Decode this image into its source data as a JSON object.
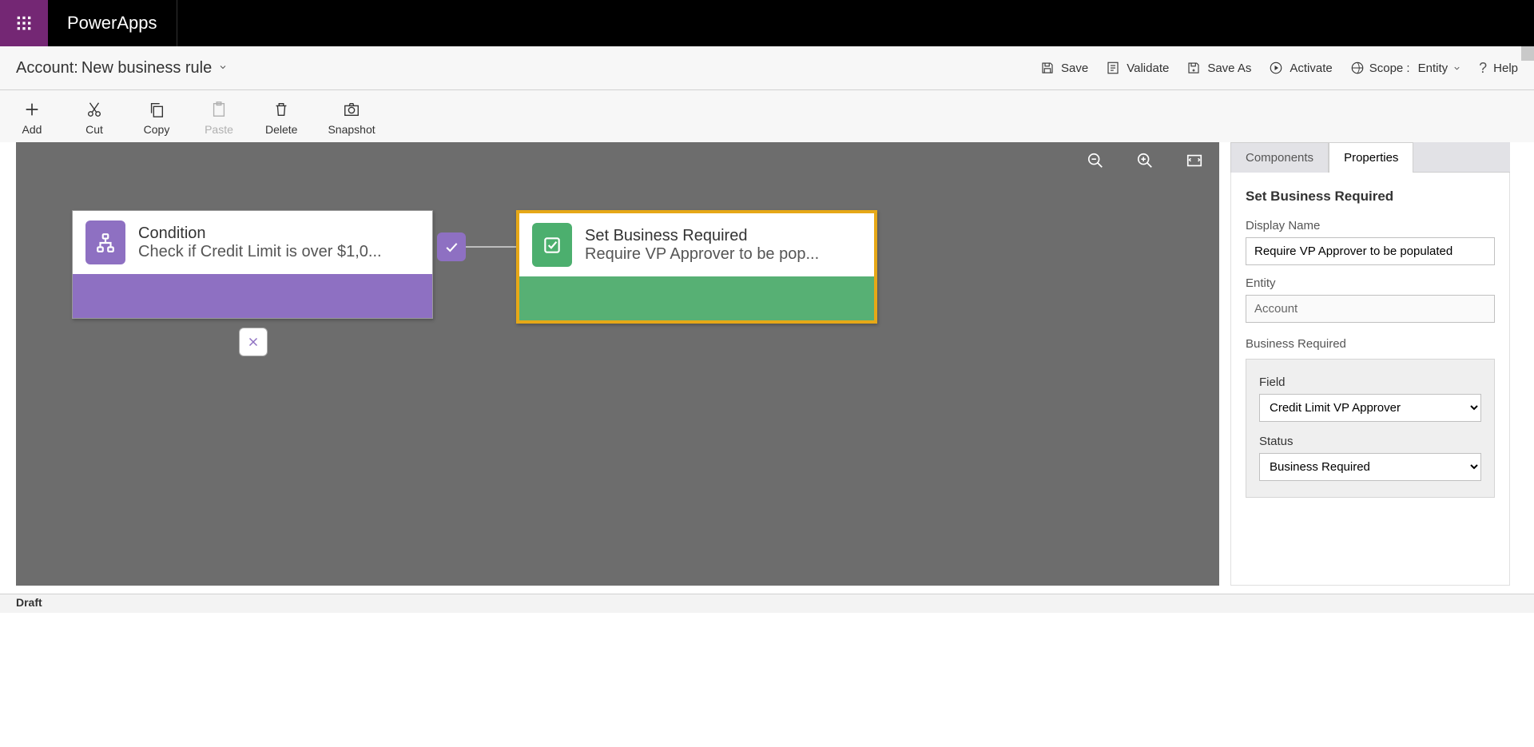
{
  "brand": "PowerApps",
  "breadcrumb": {
    "entity": "Account:",
    "name": "New business rule"
  },
  "cmdbar": {
    "save": "Save",
    "validate": "Validate",
    "saveas": "Save As",
    "activate": "Activate",
    "scope_label": "Scope :",
    "scope_value": "Entity",
    "help": "Help"
  },
  "toolbar": {
    "add": "Add",
    "cut": "Cut",
    "copy": "Copy",
    "paste": "Paste",
    "delete": "Delete",
    "snapshot": "Snapshot"
  },
  "canvas": {
    "condition": {
      "title": "Condition",
      "subtitle": "Check if Credit Limit is over $1,0..."
    },
    "action": {
      "title": "Set Business Required",
      "subtitle": "Require VP Approver to be pop..."
    }
  },
  "panel": {
    "tabs": {
      "components": "Components",
      "properties": "Properties"
    },
    "heading": "Set Business Required",
    "display_name_label": "Display Name",
    "display_name_value": "Require VP Approver to be populated",
    "entity_label": "Entity",
    "entity_value": "Account",
    "section_title": "Business Required",
    "field_label": "Field",
    "field_value": "Credit Limit VP Approver",
    "status_label": "Status",
    "status_value": "Business Required"
  },
  "status": "Draft"
}
